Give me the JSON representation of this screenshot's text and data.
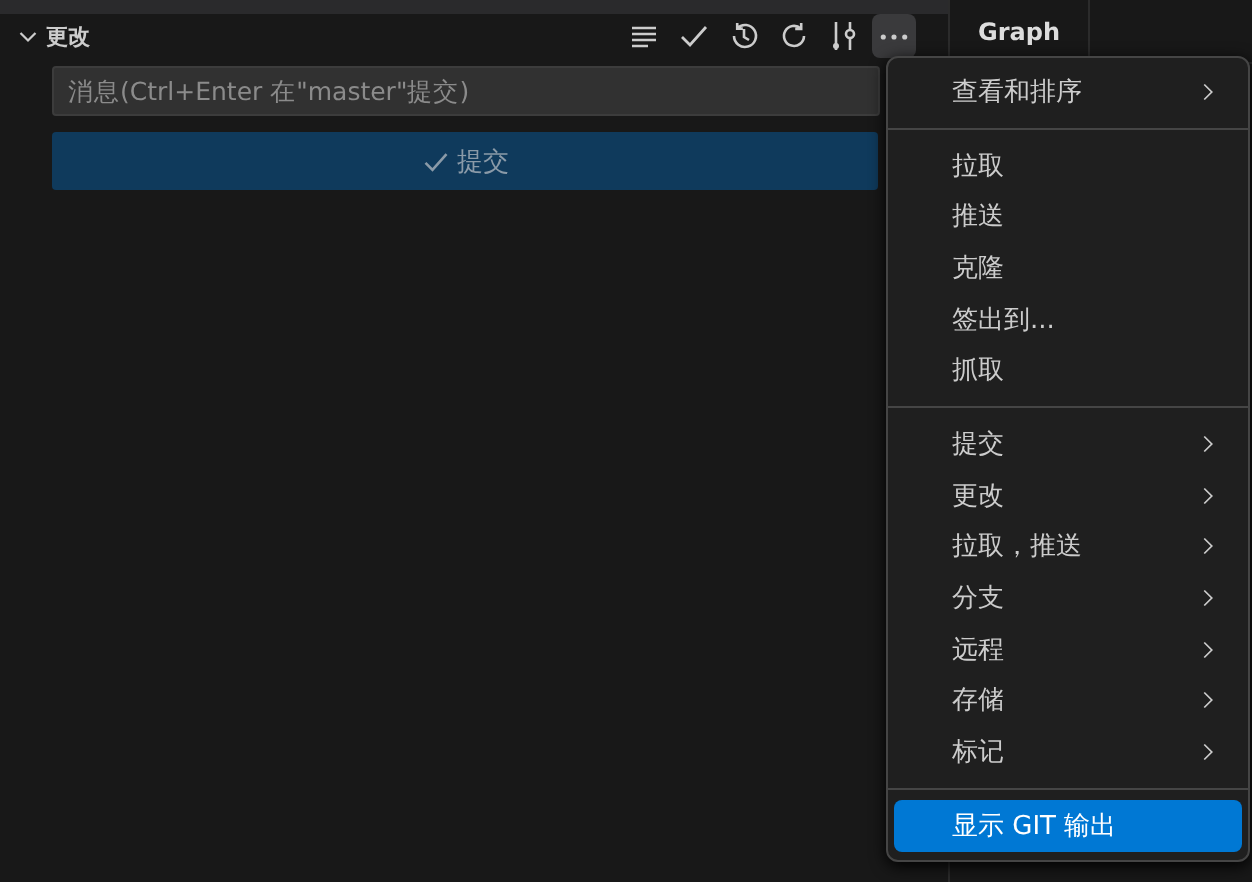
{
  "section": {
    "title": "更改",
    "expanded": true
  },
  "toolbar": [
    {
      "kind": "list",
      "active": false
    },
    {
      "kind": "check",
      "active": false
    },
    {
      "kind": "history",
      "active": false
    },
    {
      "kind": "refresh",
      "active": false
    },
    {
      "kind": "graph",
      "active": false
    },
    {
      "kind": "more",
      "active": true
    }
  ],
  "message_field": {
    "placeholder": "消息(Ctrl+Enter 在\"master\"提交)"
  },
  "commit_button": {
    "label": "提交",
    "disabled": true
  },
  "graph_tab": {
    "label": "Graph"
  },
  "menu": {
    "groups": [
      [
        {
          "label": "查看和排序",
          "submenu": true,
          "selected": false
        }
      ],
      [
        {
          "label": "拉取",
          "submenu": false,
          "selected": false
        },
        {
          "label": "推送",
          "submenu": false,
          "selected": false
        },
        {
          "label": "克隆",
          "submenu": false,
          "selected": false
        },
        {
          "label": "签出到...",
          "submenu": false,
          "selected": false
        },
        {
          "label": "抓取",
          "submenu": false,
          "selected": false
        }
      ],
      [
        {
          "label": "提交",
          "submenu": true,
          "selected": false
        },
        {
          "label": "更改",
          "submenu": true,
          "selected": false
        },
        {
          "label": "拉取，推送",
          "submenu": true,
          "selected": false
        },
        {
          "label": "分支",
          "submenu": true,
          "selected": false
        },
        {
          "label": "远程",
          "submenu": true,
          "selected": false
        },
        {
          "label": "存储",
          "submenu": true,
          "selected": false
        },
        {
          "label": "标记",
          "submenu": true,
          "selected": false
        }
      ],
      [
        {
          "label": "显示 GIT 输出",
          "submenu": false,
          "selected": true
        }
      ]
    ]
  }
}
